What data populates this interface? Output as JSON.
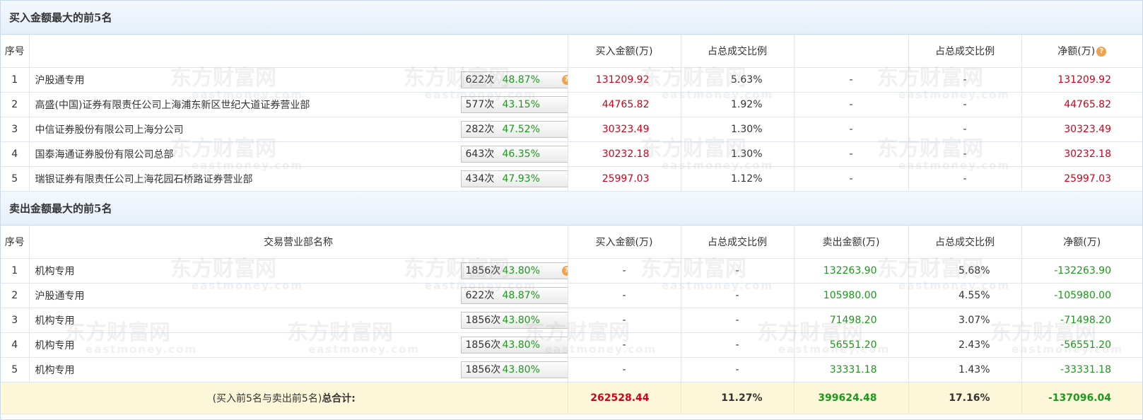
{
  "buy_section": {
    "title": "买入金额最大的前5名",
    "headers": {
      "idx": "序号",
      "name": "",
      "buy": "买入金额(万)",
      "buy_ratio": "占总成交比例",
      "sell": "",
      "sell_ratio": "占总成交比例",
      "net": "净额(万)"
    },
    "rows": [
      {
        "idx": "1",
        "name": "沪股通专用",
        "count": "622次",
        "pct": "48.87%",
        "buy": "131209.92",
        "buy_ratio": "5.63%",
        "sell": "-",
        "sell_ratio": "-",
        "net": "131209.92",
        "icon": "help-icon"
      },
      {
        "idx": "2",
        "name": "高盛(中国)证券有限责任公司上海浦东新区世纪大道证券营业部",
        "count": "577次",
        "pct": "43.15%",
        "buy": "44765.82",
        "buy_ratio": "1.92%",
        "sell": "-",
        "sell_ratio": "-",
        "net": "44765.82",
        "icon": "arrow-right-icon"
      },
      {
        "idx": "3",
        "name": "中信证券股份有限公司上海分公司",
        "count": "282次",
        "pct": "47.52%",
        "buy": "30323.49",
        "buy_ratio": "1.30%",
        "sell": "-",
        "sell_ratio": "-",
        "net": "30323.49",
        "icon": "arrow-right-icon"
      },
      {
        "idx": "4",
        "name": "国泰海通证券股份有限公司总部",
        "count": "643次",
        "pct": "46.35%",
        "buy": "30232.18",
        "buy_ratio": "1.30%",
        "sell": "-",
        "sell_ratio": "-",
        "net": "30232.18",
        "icon": "arrow-right-icon"
      },
      {
        "idx": "5",
        "name": "瑞银证券有限责任公司上海花园石桥路证券营业部",
        "count": "434次",
        "pct": "47.93%",
        "buy": "25997.03",
        "buy_ratio": "1.12%",
        "sell": "-",
        "sell_ratio": "-",
        "net": "25997.03",
        "icon": "arrow-right-icon"
      }
    ]
  },
  "sell_section": {
    "title": "卖出金额最大的前5名",
    "headers": {
      "idx": "序号",
      "name": "交易营业部名称",
      "buy": "买入金额(万)",
      "buy_ratio": "占总成交比例",
      "sell": "卖出金额(万)",
      "sell_ratio": "占总成交比例",
      "net": "净额(万)"
    },
    "rows": [
      {
        "idx": "1",
        "name": "机构专用",
        "count": "1856次",
        "pct": "43.80%",
        "buy": "-",
        "buy_ratio": "-",
        "sell": "132263.90",
        "sell_ratio": "5.68%",
        "net": "-132263.90",
        "icon": "help-icon"
      },
      {
        "idx": "2",
        "name": "沪股通专用",
        "count": "622次",
        "pct": "48.87%",
        "buy": "-",
        "buy_ratio": "-",
        "sell": "105980.00",
        "sell_ratio": "4.55%",
        "net": "-105980.00",
        "icon": "arrow-right-icon"
      },
      {
        "idx": "3",
        "name": "机构专用",
        "count": "1856次",
        "pct": "43.80%",
        "buy": "-",
        "buy_ratio": "-",
        "sell": "71498.20",
        "sell_ratio": "3.07%",
        "net": "-71498.20",
        "icon": "arrow-right-icon"
      },
      {
        "idx": "4",
        "name": "机构专用",
        "count": "1856次",
        "pct": "43.80%",
        "buy": "-",
        "buy_ratio": "-",
        "sell": "56551.20",
        "sell_ratio": "2.43%",
        "net": "-56551.20",
        "icon": "arrow-right-icon"
      },
      {
        "idx": "5",
        "name": "机构专用",
        "count": "1856次",
        "pct": "43.80%",
        "buy": "-",
        "buy_ratio": "-",
        "sell": "33331.18",
        "sell_ratio": "1.43%",
        "net": "-33331.18",
        "icon": "arrow-right-icon"
      }
    ]
  },
  "total": {
    "label_prefix": "(买入前5名与卖出前5名)",
    "label_bold": "总合计:",
    "buy": "262528.44",
    "buy_ratio": "11.27%",
    "sell": "399624.48",
    "sell_ratio": "17.16%",
    "net": "-137096.04"
  },
  "watermark": {
    "text": "东方财富网",
    "sub": "eastmoney.com"
  },
  "colors": {
    "positive": "#d0021b",
    "negative": "#1a9a1a",
    "header_bg": "#e6eff9",
    "total_bg": "#fcf7d9"
  }
}
